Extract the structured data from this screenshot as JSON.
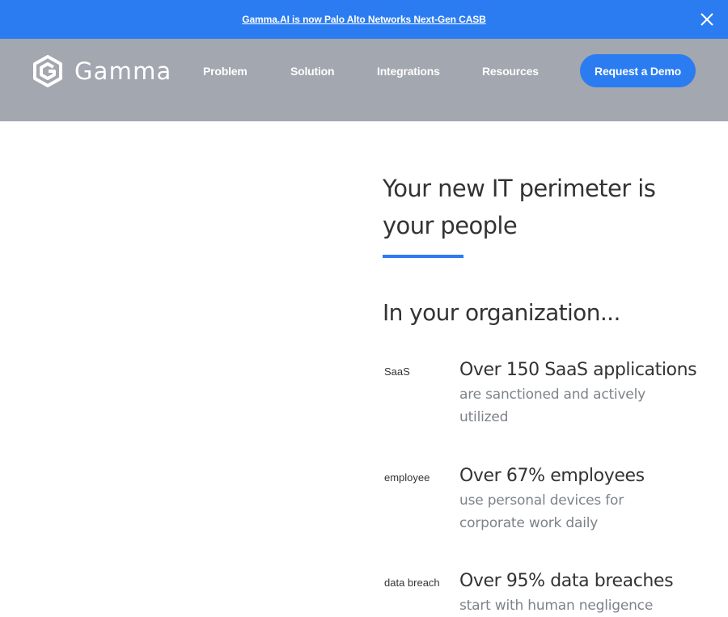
{
  "announcement": {
    "text": "Gamma.AI is now Palo Alto Networks Next-Gen CASB",
    "close_icon": "close-icon"
  },
  "header": {
    "logo_text": "Gamma",
    "nav": [
      {
        "label": "Problem"
      },
      {
        "label": "Solution"
      },
      {
        "label": "Integrations"
      },
      {
        "label": "Resources"
      }
    ],
    "cta_label": "Request a Demo"
  },
  "hero": {
    "title_line1": "Your new IT perimeter is",
    "title_line2": "your people"
  },
  "section": {
    "title": "In your organization..."
  },
  "stats": [
    {
      "img_alt": "SaaS",
      "headline": "Over 150 SaaS applications",
      "desc": "are sanctioned and actively utilized"
    },
    {
      "img_alt": "employee",
      "headline": "Over 67% employees",
      "desc": "use personal devices for corporate work daily"
    },
    {
      "img_alt": "data breach",
      "headline": "Over 95% data breaches",
      "desc": "start with human negligence"
    }
  ],
  "colors": {
    "accent": "#2b7cf1",
    "navbar": "#a2a7b0",
    "muted_text": "#7d838b"
  }
}
